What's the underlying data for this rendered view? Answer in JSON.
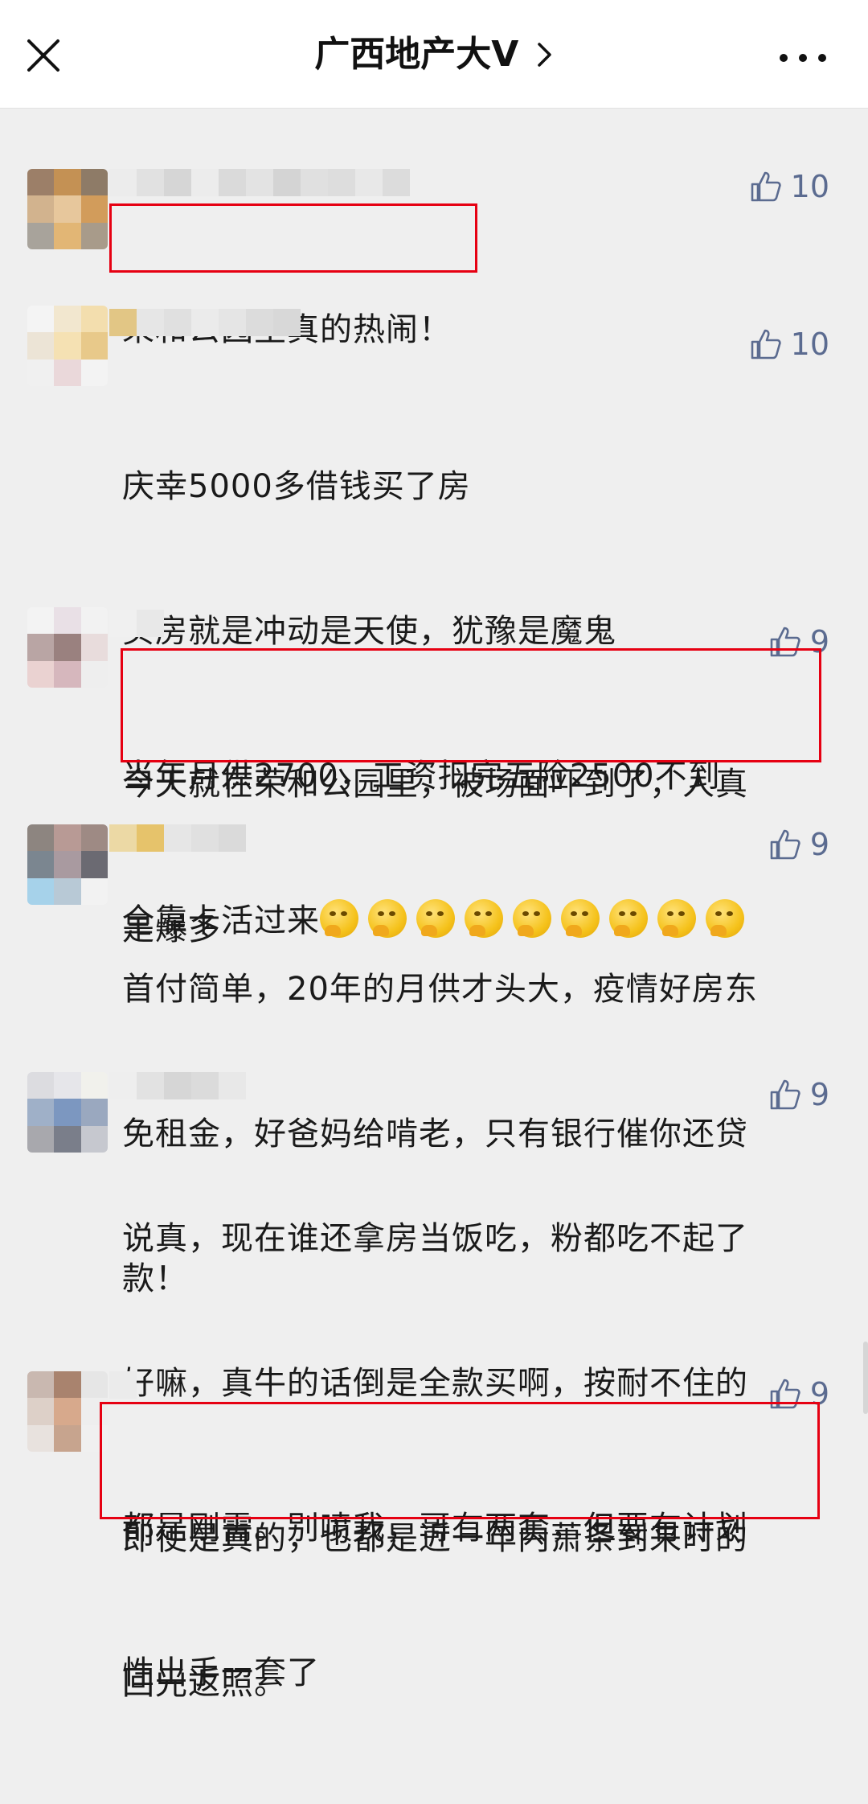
{
  "header": {
    "title": "广西地产大V",
    "close_icon": "close-icon",
    "chevron_icon": "chevron-right-icon",
    "more_icon": "more-icon"
  },
  "comments": [
    {
      "likes": "10",
      "lines": [
        "荣和公园里真的热闹！"
      ],
      "highlighted": true
    },
    {
      "likes": "10",
      "lines": [
        "庆幸5000多借钱买了房",
        "买房就是冲动是天使，犹豫是魔鬼",
        "当年月供2700，工资扣完五险2500不到",
        "全靠卡活过来"
      ],
      "emoji": "thinking-face-emoji",
      "emoji_count": 9,
      "highlighted": false
    },
    {
      "likes": "9",
      "lines": [
        "今天就在荣和公园里，被场面吓到了，人真",
        "是爆多"
      ],
      "highlighted": true
    },
    {
      "likes": "9",
      "lines": [
        "首付简单，20年的月供才头大，疫情好房东",
        "免租金，好爸妈给啃老，只有银行催你还贷",
        "款！"
      ],
      "highlighted": false
    },
    {
      "likes": "9",
      "lines": [
        "说真，现在谁还拿房当饭吃，粉都吃不起了",
        "好嘛，真牛的话倒是全款买啊，按耐不住的",
        "都是刚需。别喷我，哥有两套，但要有计划",
        "性出手一套了"
      ],
      "highlighted": false
    },
    {
      "likes": "9",
      "lines": [
        "即使是真的，也都是近一年内萧条到来时的",
        "回光返照。"
      ],
      "highlighted": true
    }
  ],
  "colors": {
    "highlight": "#e60012",
    "like": "#5b6b90",
    "background": "#efefef"
  }
}
